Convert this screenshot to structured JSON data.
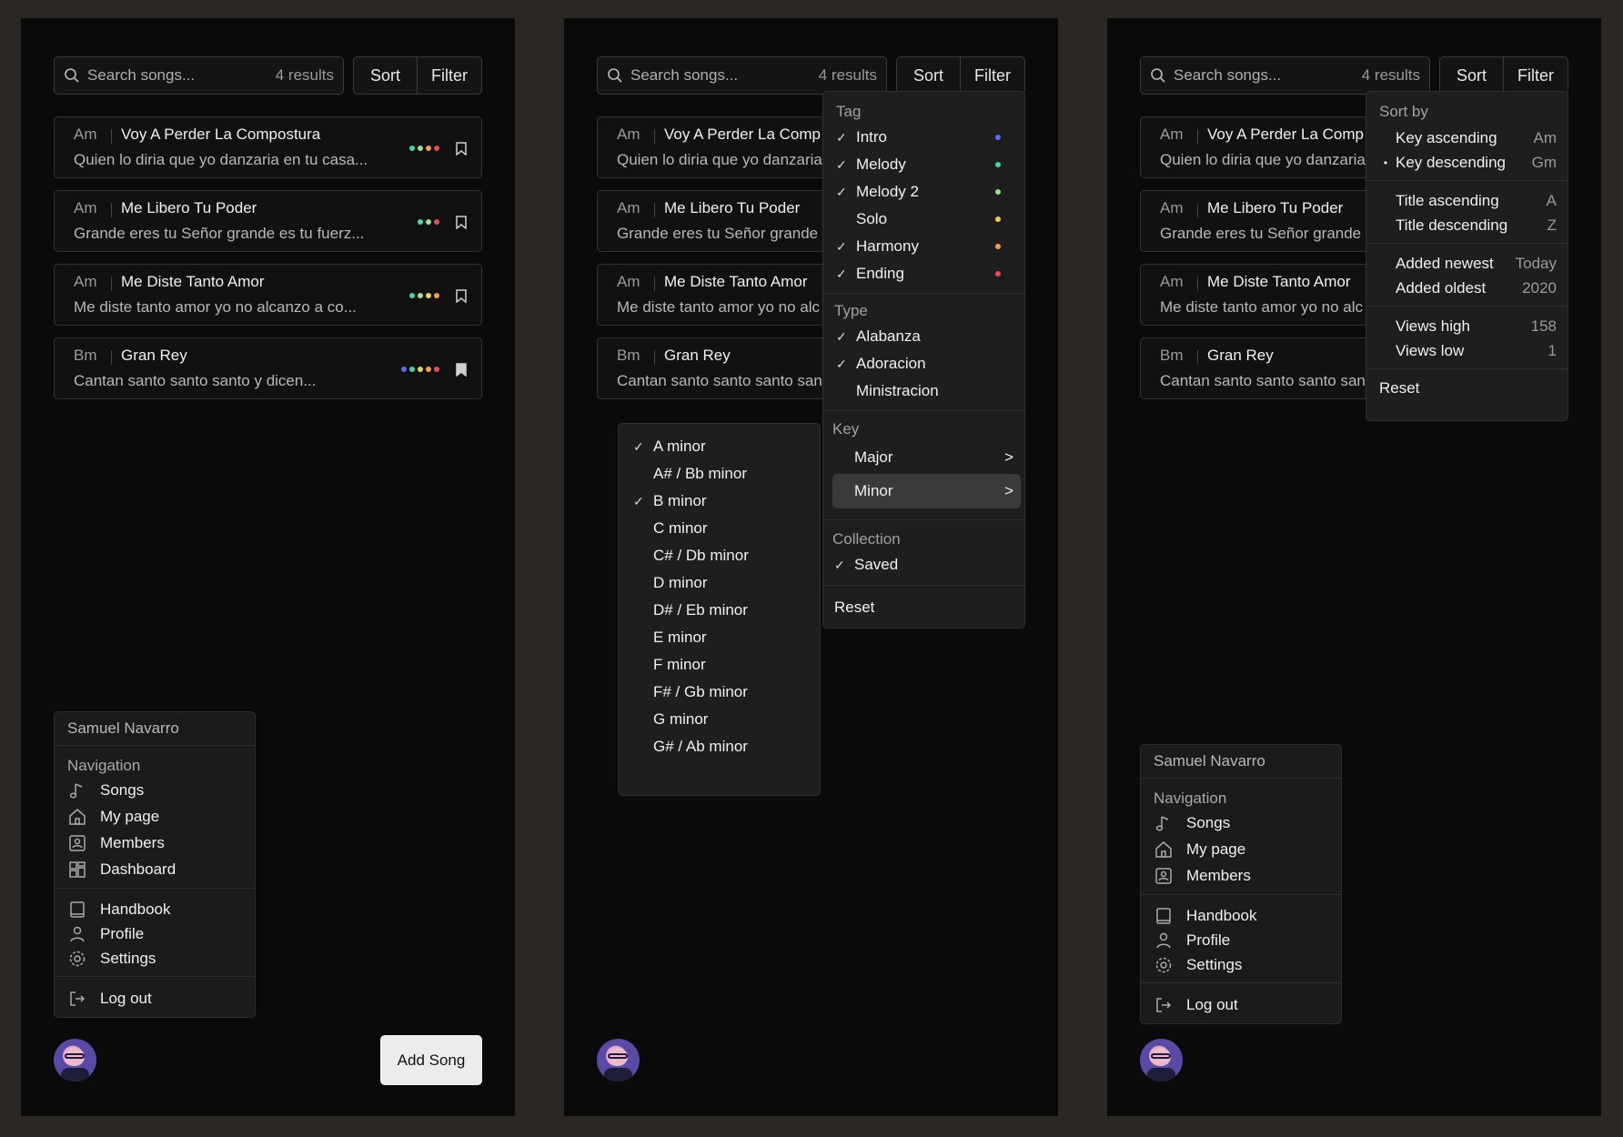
{
  "search": {
    "placeholder": "Search songs...",
    "count": "4 results"
  },
  "toolbar": {
    "sort_label": "Sort",
    "filter_label": "Filter"
  },
  "songs": [
    {
      "key": "Am",
      "title": "Voy A Perder La Compostura",
      "title_short": "Voy A Perder La Comp",
      "lyric": "Quien lo diria que yo danzaria en tu casa...",
      "lyric_short": "Quien lo diria que yo danzaria",
      "lyric_short3": "Quien lo diria que yo danzaria",
      "dots": [
        "#4cd1a8",
        "#9fe08a",
        "#f0a050",
        "#e05050"
      ],
      "saved": false
    },
    {
      "key": "Am",
      "title": "Me Libero Tu Poder",
      "title_short": "Me Libero Tu Poder",
      "lyric": "Grande eres tu Señor grande es tu fuerz...",
      "lyric_short": "Grande eres tu Señor grande",
      "lyric_short3": "Grande eres tu Señor grande",
      "dots": [
        "#4cd1a8",
        "#9fe08a",
        "#e05050"
      ],
      "saved": false
    },
    {
      "key": "Am",
      "title": "Me Diste Tanto Amor",
      "title_short": "Me Diste Tanto Amor",
      "lyric": "Me diste tanto amor yo no alcanzo a co...",
      "lyric_short": "Me diste tanto amor yo no alc",
      "lyric_short3": "Me diste tanto amor yo no alc",
      "dots": [
        "#4cd1a8",
        "#9fe08a",
        "#e8d060",
        "#f0a050"
      ],
      "saved": false
    },
    {
      "key": "Bm",
      "title": "Gran Rey",
      "title_short": "Gran Rey",
      "lyric": "Cantan santo santo santo y dicen...",
      "lyric_short": "Cantan santo santo santo san",
      "lyric_short3": "Cantan santo santo santo san",
      "dots": [
        "#5a6cf0",
        "#4cd1a8",
        "#e8d060",
        "#f0a050",
        "#e05050"
      ],
      "saved": true
    }
  ],
  "user_menu": {
    "user_name": "Samuel Navarro",
    "nav_header": "Navigation",
    "songs": "Songs",
    "my_page": "My page",
    "members": "Members",
    "dashboard": "Dashboard",
    "handbook": "Handbook",
    "profile": "Profile",
    "settings": "Settings",
    "logout": "Log out"
  },
  "add_song_label": "Add Song",
  "filter_menu": {
    "tag_header": "Tag",
    "tags": [
      {
        "label": "Intro",
        "checked": true,
        "color": "#5a6cf0"
      },
      {
        "label": "Melody",
        "checked": true,
        "color": "#4cd1a8"
      },
      {
        "label": "Melody 2",
        "checked": true,
        "color": "#9fe08a"
      },
      {
        "label": "Solo",
        "checked": false,
        "color": "#e8d060"
      },
      {
        "label": "Harmony",
        "checked": true,
        "color": "#f0a050"
      },
      {
        "label": "Ending",
        "checked": true,
        "color": "#e05050"
      }
    ],
    "type_header": "Type",
    "types": [
      {
        "label": "Alabanza",
        "checked": true
      },
      {
        "label": "Adoracion",
        "checked": true
      },
      {
        "label": "Ministracion",
        "checked": false
      }
    ],
    "key_header": "Key",
    "major": "Major",
    "minor": "Minor",
    "arrow": ">",
    "collection_header": "Collection",
    "saved": "Saved",
    "reset": "Reset"
  },
  "minor_keys": [
    {
      "label": "A minor",
      "checked": true
    },
    {
      "label": "A# / Bb minor",
      "checked": false
    },
    {
      "label": "B minor",
      "checked": true
    },
    {
      "label": "C minor",
      "checked": false
    },
    {
      "label": "C# / Db minor",
      "checked": false
    },
    {
      "label": "D minor",
      "checked": false
    },
    {
      "label": "D# / Eb minor",
      "checked": false
    },
    {
      "label": "E minor",
      "checked": false
    },
    {
      "label": "F minor",
      "checked": false
    },
    {
      "label": "F# / Gb minor",
      "checked": false
    },
    {
      "label": "G minor",
      "checked": false
    },
    {
      "label": "G# / Ab minor",
      "checked": false
    }
  ],
  "sort_menu": {
    "header": "Sort by",
    "groups": [
      [
        {
          "label": "Key ascending",
          "value": "Am",
          "selected": false
        },
        {
          "label": "Key descending",
          "value": "Gm",
          "selected": true
        }
      ],
      [
        {
          "label": "Title ascending",
          "value": "A",
          "selected": false
        },
        {
          "label": "Title descending",
          "value": "Z",
          "selected": false
        }
      ],
      [
        {
          "label": "Added newest",
          "value": "Today",
          "selected": false
        },
        {
          "label": "Added oldest",
          "value": "2020",
          "selected": false
        }
      ],
      [
        {
          "label": "Views high",
          "value": "158",
          "selected": false
        },
        {
          "label": "Views low",
          "value": "1",
          "selected": false
        }
      ]
    ],
    "reset": "Reset",
    "check_glyph": "✓",
    "bullet_glyph": "•"
  }
}
